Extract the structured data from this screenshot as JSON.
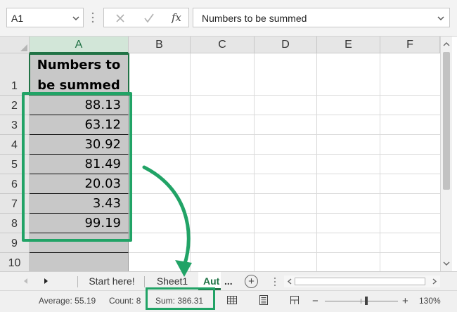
{
  "formula_bar": {
    "name_box": "A1",
    "func_label": "fx",
    "formula_value": "Numbers to be summed"
  },
  "grid": {
    "columns": [
      "A",
      "B",
      "C",
      "D",
      "E",
      "F"
    ],
    "rows": [
      "1",
      "2",
      "3",
      "4",
      "5",
      "6",
      "7",
      "8",
      "9",
      "10"
    ],
    "header_cell": {
      "line1": "Numbers to",
      "line2": "be summed"
    },
    "values": [
      "88.13",
      "63.12",
      "30.92",
      "81.49",
      "20.03",
      "3.43",
      "99.19"
    ]
  },
  "sheet_tabs": {
    "tabs": [
      "Start here!",
      "Sheet1",
      "Aut"
    ],
    "active_index": 2,
    "more_label": "...",
    "add_label": "+"
  },
  "status_bar": {
    "average": "Average:   55.19",
    "count": "Count: 8",
    "sum": "Sum:   386.31",
    "zoom_minus": "−",
    "zoom_plus": "+",
    "zoom_level": "130%"
  },
  "colors": {
    "accent": "#217346",
    "highlight": "#21a366",
    "cell_fill": "#c8c8c8"
  },
  "icons": [
    "chevron-down-icon",
    "cancel-icon",
    "enter-icon",
    "function-icon",
    "select-all-icon",
    "scroll-up-icon",
    "scroll-down-icon",
    "tab-prev-icon",
    "tab-next-icon",
    "add-sheet-icon",
    "normal-view-icon",
    "page-layout-icon",
    "page-break-icon"
  ]
}
